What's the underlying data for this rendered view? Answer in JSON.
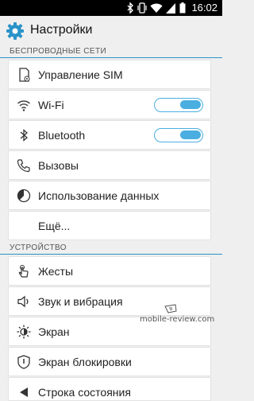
{
  "status_bar": {
    "time": "16:02",
    "icons": [
      "bluetooth-icon",
      "vibrate-icon",
      "wifi-icon",
      "signal-icon",
      "battery-icon"
    ]
  },
  "header": {
    "title": "Настройки",
    "icon": "gear-icon",
    "accent": "#2a93c9"
  },
  "sections": {
    "wireless": "БЕСПРОВОДНЫЕ СЕТИ",
    "device": "УСТРОЙСТВО"
  },
  "items": {
    "sim": {
      "label": "Управление SIM",
      "icon": "sim-icon"
    },
    "wifi": {
      "label": "Wi-Fi",
      "icon": "wifi-icon",
      "enabled": true
    },
    "bluetooth": {
      "label": "Bluetooth",
      "icon": "bluetooth-icon",
      "enabled": true
    },
    "calls": {
      "label": "Вызовы",
      "icon": "phone-icon"
    },
    "data_usage": {
      "label": "Использование данных",
      "icon": "data-usage-icon"
    },
    "more": {
      "label": "Ещё..."
    },
    "gestures": {
      "label": "Жесты",
      "icon": "gesture-icon"
    },
    "sound": {
      "label": "Звук и вибрация",
      "icon": "speaker-icon"
    },
    "display": {
      "label": "Экран",
      "icon": "brightness-icon"
    },
    "lockscreen": {
      "label": "Экран блокировки",
      "icon": "lock-shield-icon"
    },
    "statusbar": {
      "label": "Строка состояния",
      "icon": "statusbar-icon"
    }
  },
  "toggle_color": "#4aaee0",
  "watermark": "mobile-review.com"
}
